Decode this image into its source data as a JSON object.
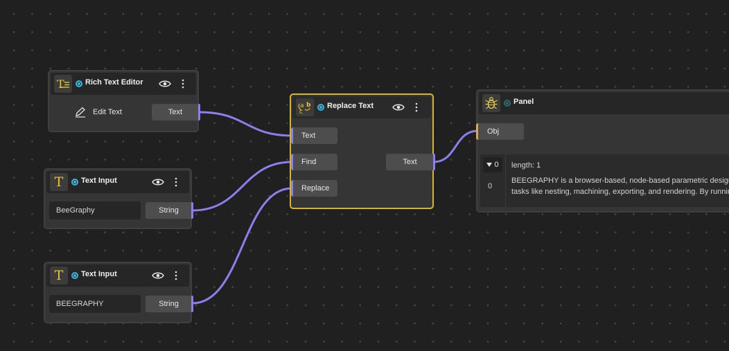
{
  "nodes": {
    "rich_text_editor": {
      "title": "Rich Text Editor",
      "edit_label": "Edit Text",
      "output_label": "Text"
    },
    "text_input_1": {
      "title": "Text Input",
      "value": "BeeGraphy",
      "output_label": "String"
    },
    "text_input_2": {
      "title": "Text Input",
      "value": "BEEGRAPHY",
      "output_label": "String"
    },
    "replace_text": {
      "title": "Replace Text",
      "icon_text": "a b c",
      "inputs": [
        "Text",
        "Find",
        "Replace"
      ],
      "output_label": "Text"
    },
    "panel": {
      "title": "Panel",
      "input_label": "Obj",
      "collapse_label": "0",
      "length_label": "length: 1",
      "row_index": "0",
      "row_text_line1": "BEEGRAPHY is a browser-based, node-based parametric design",
      "row_text_line2": "tasks like nesting, machining, exporting, and rendering. By runnin"
    }
  },
  "colors": {
    "wire": "#8a80f0",
    "selected_border": "#d8b52a",
    "status_active": "#3ab7e0",
    "icon_yellow": "#e8c531",
    "obj_port": "#e0a84c"
  },
  "icons": {
    "rich_text_editor": "text-lines-icon",
    "text_input": "letter-t-icon",
    "replace_text": "abc-replace-icon",
    "panel": "bug-icon",
    "edit": "pencil-icon",
    "visibility": "eye-icon",
    "menu": "vertical-dots-icon"
  }
}
